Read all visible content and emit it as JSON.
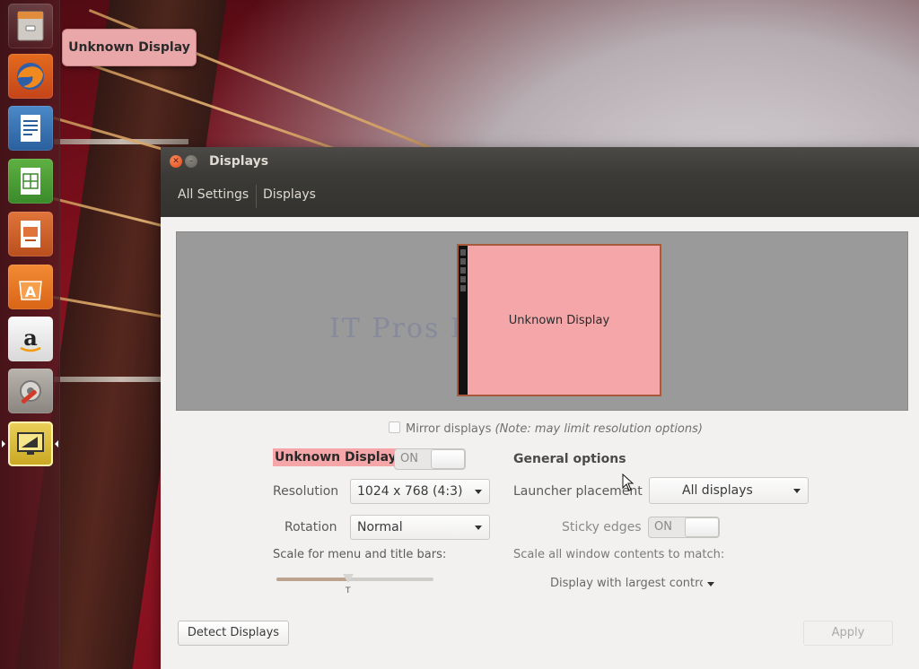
{
  "tooltip": {
    "text": "Unknown Display"
  },
  "launcher": {
    "items": [
      {
        "icon": "files-icon"
      },
      {
        "icon": "firefox-icon"
      },
      {
        "icon": "writer-icon"
      },
      {
        "icon": "calc-icon"
      },
      {
        "icon": "impress-icon"
      },
      {
        "icon": "software-center-icon"
      },
      {
        "icon": "amazon-icon"
      },
      {
        "icon": "system-settings-icon"
      },
      {
        "icon": "displays-icon"
      }
    ]
  },
  "window": {
    "title": "Displays",
    "breadcrumb": {
      "all_settings": "All Settings",
      "current": "Displays"
    }
  },
  "arrangement": {
    "monitor_label": "Unknown Display",
    "watermark": "IT Pros HUB"
  },
  "mirror": {
    "label": "Mirror displays",
    "note": "(Note: may limit resolution options)"
  },
  "display": {
    "name": "Unknown Display",
    "toggle_label": "ON",
    "resolution_label": "Resolution",
    "resolution_value": "1024 x 768 (4:3)",
    "rotation_label": "Rotation",
    "rotation_value": "Normal",
    "scale_label": "Scale for menu and title bars:",
    "scale_value": 0.45
  },
  "general": {
    "heading": "General options",
    "launcher_label": "Launcher placement",
    "launcher_value": "All displays",
    "sticky_label": "Sticky edges",
    "sticky_toggle": "ON",
    "scale_all_label": "Scale all window contents to match:",
    "scale_all_value": "Display with largest controls"
  },
  "buttons": {
    "detect": "Detect Displays",
    "apply": "Apply"
  },
  "colors": {
    "accent": "#f4a6a8",
    "titlebar": "#3b3a37",
    "close": "#df4a17"
  }
}
